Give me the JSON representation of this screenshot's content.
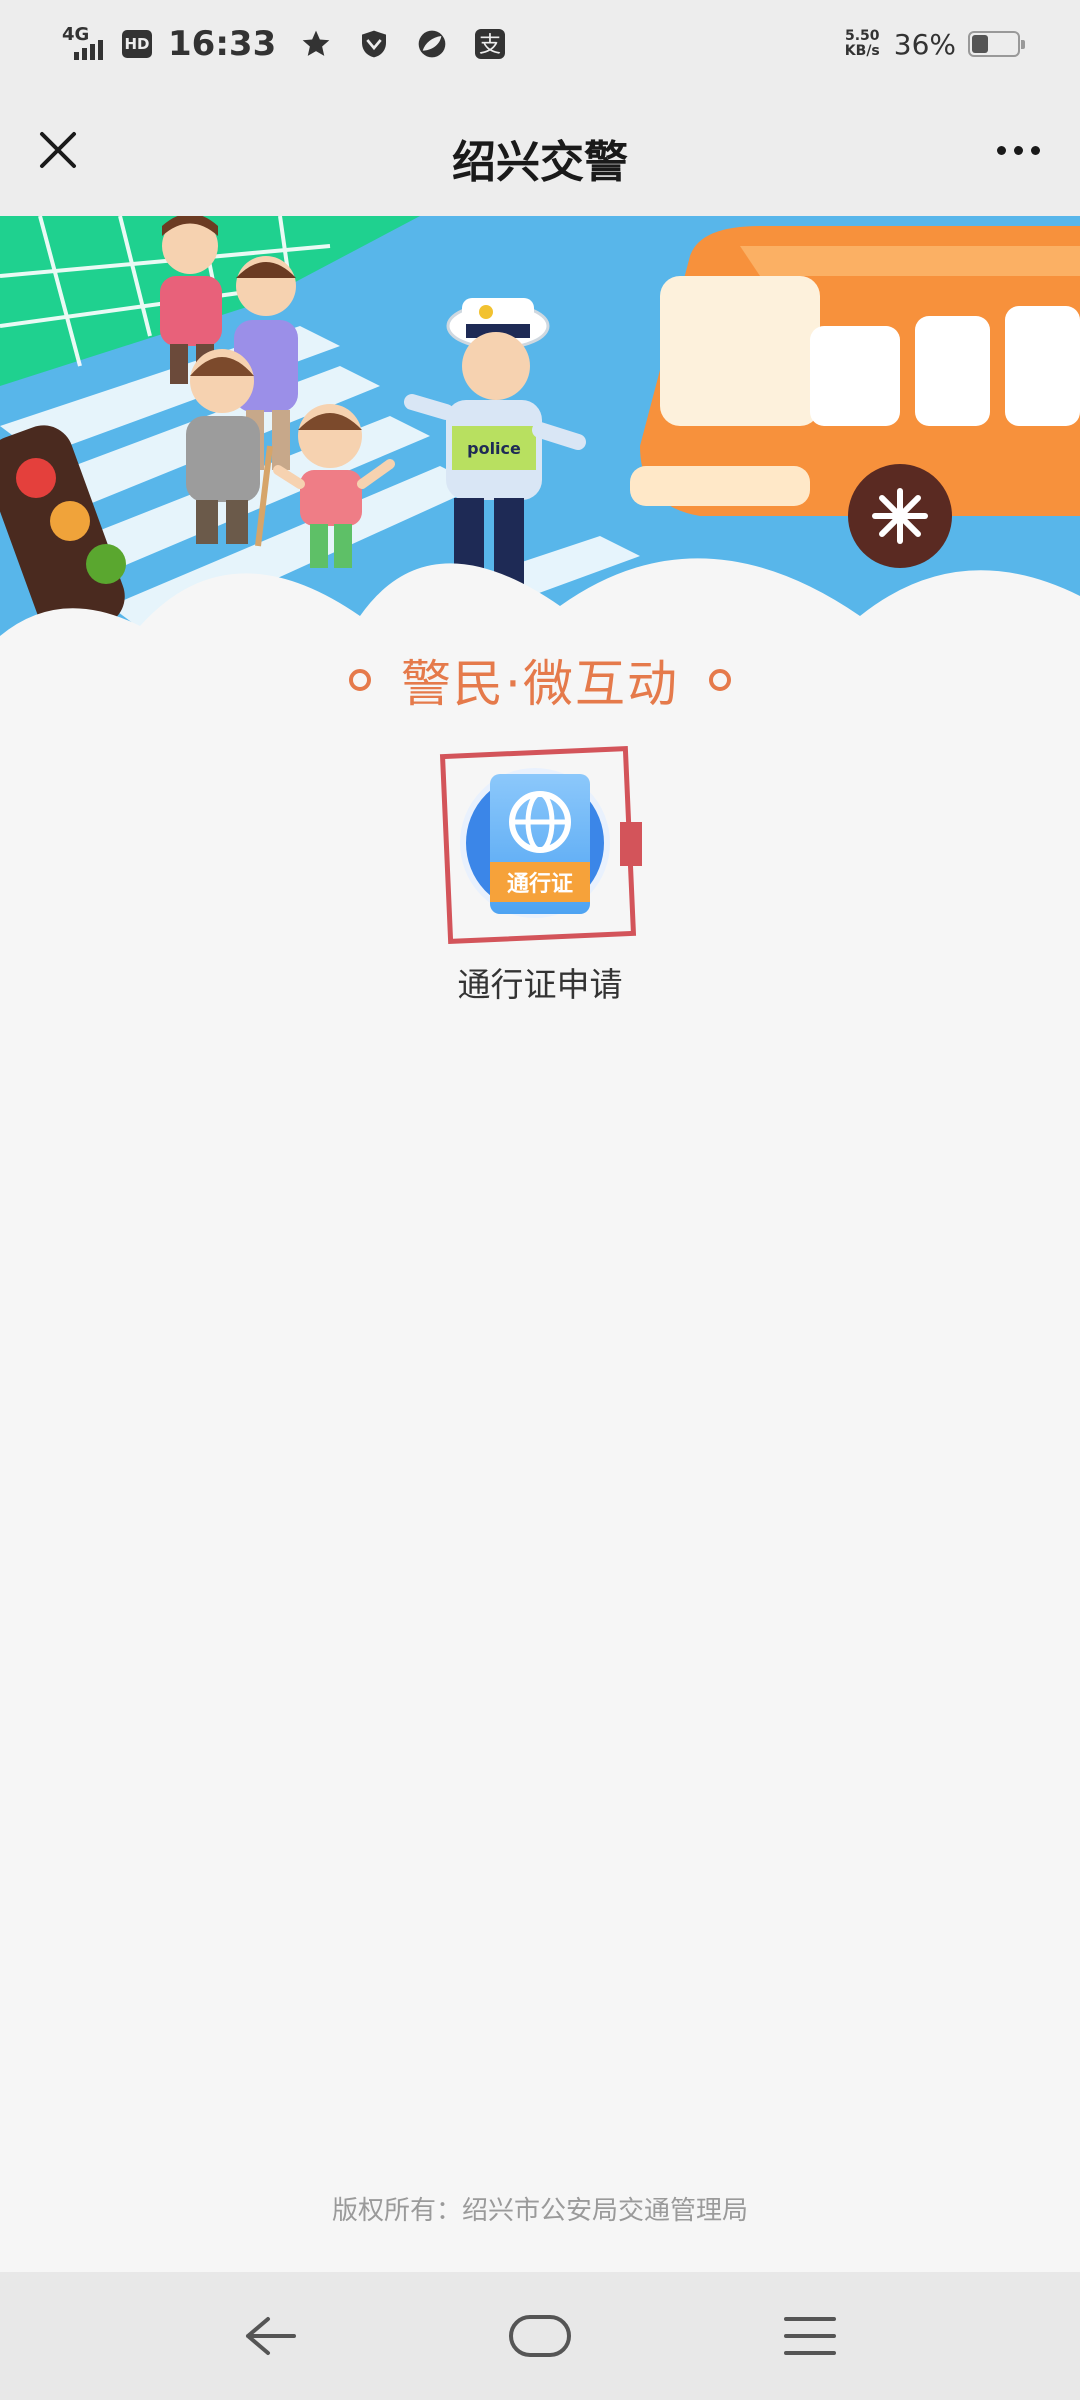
{
  "status_bar": {
    "network": "4G",
    "hd_label": "HD",
    "time": "16:33",
    "net_speed_value": "5.50",
    "net_speed_unit": "KB/s",
    "battery_percent": "36%",
    "battery_level": 0.36,
    "notification_icons": [
      "star-icon",
      "shield-icon",
      "leaf-icon",
      "alipay-icon"
    ],
    "alipay_glyph": "支"
  },
  "title_bar": {
    "title": "绍兴交警",
    "close_icon": "close-icon",
    "more_icon": "more-icon"
  },
  "banner": {
    "police_badge_text": "police"
  },
  "section": {
    "heading": "警民·微互动"
  },
  "apps": [
    {
      "label": "通行证申请",
      "badge_text": "通行证",
      "icon": "globe-icon"
    }
  ],
  "footer": {
    "copyright": "版权所有：绍兴市公安局交通管理局"
  },
  "nav_bar": {
    "icons": [
      "back-icon",
      "home-icon",
      "menu-icon"
    ]
  },
  "colors": {
    "accent_orange": "#e57a4b",
    "highlight_red": "#d3545a",
    "app_blue": "#3b86e8",
    "badge_orange": "#f6a23a",
    "background": "#f6f6f6"
  }
}
